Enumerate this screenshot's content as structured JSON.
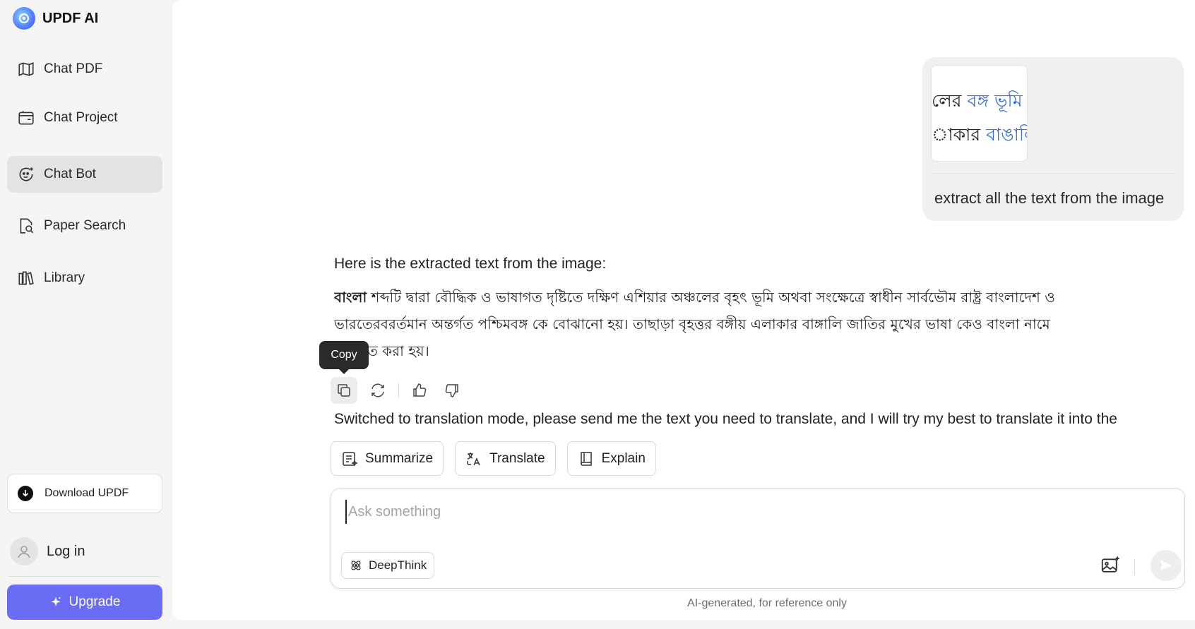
{
  "brand": {
    "name": "UPDF AI"
  },
  "sidebar": {
    "items": [
      {
        "label": "Chat PDF",
        "icon": "book-open-icon"
      },
      {
        "label": "Chat Project",
        "icon": "folder-icon"
      },
      {
        "label": "Chat Bot",
        "icon": "chatbot-icon",
        "active": true
      },
      {
        "label": "Paper Search",
        "icon": "paper-search-icon"
      },
      {
        "label": "Library",
        "icon": "library-icon"
      }
    ],
    "download_label": "Download UPDF",
    "login_label": "Log in",
    "upgrade_label": "Upgrade"
  },
  "conversation": {
    "user_message": {
      "image_text_line1_dark": "লের ",
      "image_text_line1_blue": "বঙ্গ ভূমি",
      "image_text_line2_dark": "াকার ",
      "image_text_line2_blue": "বাঙালি জ",
      "text": "extract all the text from the image"
    },
    "assistant": {
      "intro": "Here is the extracted text from the image:",
      "body_bold": "বাংলা",
      "body_line1": " শব্দটি দ্বারা বৌদ্ধিক ও ভাষাগত দৃষ্টিতে দক্ষিণ এশিয়ার অঞ্চলের বৃহৎ ভূমি অথবা সংক্ষেত্রে স্বাধীন সার্বভৌম রাষ্ট্র বাংলাদেশ ও",
      "body_line2": "ভারতেরবরর্তমান অন্তর্গত পশ্চিমবঙ্গ কে বোঝানো হয়। তাছাড়া বৃহত্তর বঙ্গীয় এলাকার বাঙ্গালি জাতির মুখের ভাষা কেও বাংলা নামে",
      "body_line3": "পরিচিত করা হয়।",
      "tooltip": "Copy",
      "next_message": "Switched to translation mode, please send me the text you need to translate, and I will try my best to translate it into the"
    }
  },
  "quick_actions": [
    {
      "label": "Summarize",
      "icon": "summarize-icon"
    },
    {
      "label": "Translate",
      "icon": "translate-icon"
    },
    {
      "label": "Explain",
      "icon": "book-icon"
    }
  ],
  "composer": {
    "placeholder": "Ask something",
    "value": "",
    "deepthink_label": "DeepThink"
  },
  "footnote": "AI-generated, for reference only",
  "colors": {
    "accent": "#6b6cf6",
    "sidebar_active": "#e3e3e5",
    "link_blue": "#3b6fd8"
  }
}
